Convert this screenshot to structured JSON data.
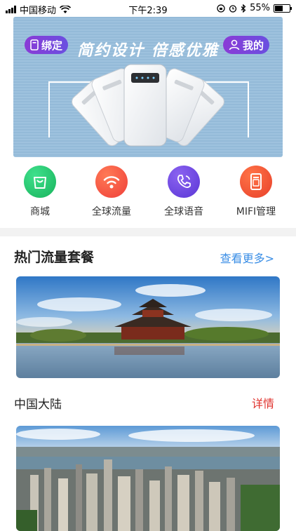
{
  "status_bar": {
    "carrier": "中国移动",
    "time": "下午2:39",
    "battery": "55%"
  },
  "banner": {
    "title": "简约设计  倍感优雅",
    "bind_label": "绑定",
    "mine_label": "我的"
  },
  "quick_actions": [
    {
      "label": "商城",
      "icon": "shopping-bag-icon",
      "color": "#27c46d"
    },
    {
      "label": "全球流量",
      "icon": "wifi-icon",
      "color": "#f35a45"
    },
    {
      "label": "全球语音",
      "icon": "phone-icon",
      "color": "#6b46e0"
    },
    {
      "label": "MIFI管理",
      "icon": "device-icon",
      "color": "#f04c2c"
    }
  ],
  "section": {
    "title": "热门流量套餐",
    "more": "查看更多>"
  },
  "cards": [
    {
      "name": "中国大陆",
      "detail": "详情"
    }
  ],
  "colors": {
    "accent_blue": "#3a8ee6",
    "detail_red": "#e0322d",
    "pill_purple": "#7a45dc"
  }
}
